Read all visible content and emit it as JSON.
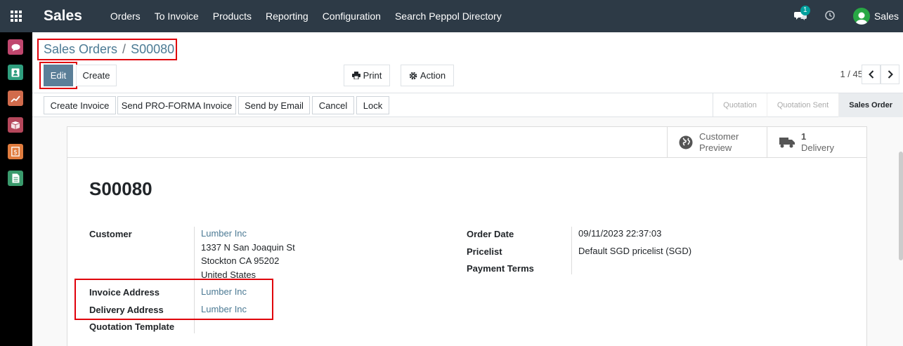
{
  "app": {
    "title": "Sales",
    "menu": [
      "Orders",
      "To Invoice",
      "Products",
      "Reporting",
      "Configuration",
      "Search Peppol Directory"
    ],
    "chat_count": "1",
    "user": "Sales"
  },
  "sidebar": {
    "apps": [
      {
        "name": "discuss-app-icon",
        "color": "#c0476e"
      },
      {
        "name": "contacts-app-icon",
        "color": "#2f9e7e"
      },
      {
        "name": "sales-app-icon",
        "color": "#d16b4c"
      },
      {
        "name": "inventory-app-icon",
        "color": "#b5475b"
      },
      {
        "name": "invoicing-app-icon",
        "color": "#e07c3e"
      },
      {
        "name": "documents-app-icon",
        "color": "#3a9a6c"
      }
    ]
  },
  "breadcrumb": {
    "parent": "Sales Orders",
    "separator": "/",
    "current": "S00080"
  },
  "buttons": {
    "edit": "Edit",
    "create": "Create",
    "print": "Print",
    "action": "Action"
  },
  "pager": {
    "text": "1 / 45"
  },
  "status_buttons": [
    "Create Invoice",
    "Send PRO-FORMA Invoice",
    "Send by Email",
    "Cancel",
    "Lock"
  ],
  "stages": [
    "Quotation",
    "Quotation Sent",
    "Sales Order"
  ],
  "active_stage": "Sales Order",
  "smart_buttons": {
    "preview_line1": "Customer",
    "preview_line2": "Preview",
    "delivery_count": "1",
    "delivery_label": "Delivery"
  },
  "order": {
    "name": "S00080",
    "customer_label": "Customer",
    "customer": "Lumber Inc",
    "address": [
      "1337 N San Joaquin St",
      "Stockton CA 95202",
      "United States"
    ],
    "invoice_address_label": "Invoice Address",
    "invoice_address": "Lumber Inc",
    "delivery_address_label": "Delivery Address",
    "delivery_address": "Lumber Inc",
    "quotation_template_label": "Quotation Template",
    "order_date_label": "Order Date",
    "order_date": "09/11/2023 22:37:03",
    "pricelist_label": "Pricelist",
    "pricelist": "Default SGD pricelist (SGD)",
    "payment_terms_label": "Payment Terms"
  },
  "colors": {
    "navbar": "#2d3a46",
    "primary": "#5b7f98",
    "link": "#4c7a94",
    "highlight": "#e0000b"
  }
}
